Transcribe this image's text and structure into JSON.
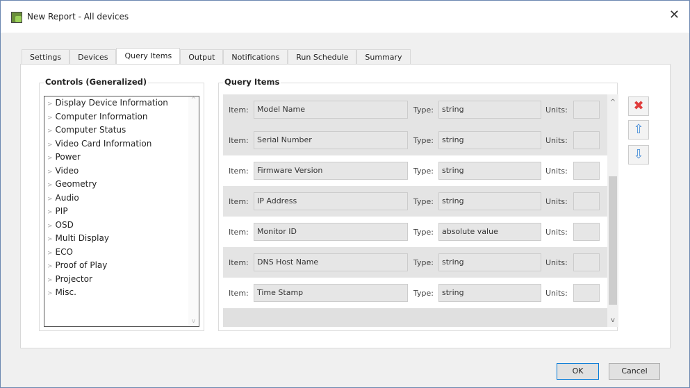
{
  "window": {
    "title": "New Report - All devices"
  },
  "tabs": [
    "Settings",
    "Devices",
    "Query Items",
    "Output",
    "Notifications",
    "Run Schedule",
    "Summary"
  ],
  "active_tab": "Query Items",
  "controls": {
    "label": "Controls (Generalized)",
    "items": [
      "Display Device Information",
      "Computer Information",
      "Computer Status",
      "Video Card Information",
      "Power",
      "Video",
      "Geometry",
      "Audio",
      "PIP",
      "OSD",
      "Multi Display",
      "ECO",
      "Proof of Play",
      "Projector",
      "Misc."
    ]
  },
  "query": {
    "label": "Query Items",
    "item_label": "Item:",
    "type_label": "Type:",
    "units_label": "Units:",
    "rows": [
      {
        "item": "Model Name",
        "type": "string",
        "units": ""
      },
      {
        "item": "Serial Number",
        "type": "string",
        "units": ""
      },
      {
        "item": "Firmware Version",
        "type": "string",
        "units": ""
      },
      {
        "item": "IP Address",
        "type": "string",
        "units": ""
      },
      {
        "item": "Monitor ID",
        "type": "absolute value",
        "units": ""
      },
      {
        "item": "DNS Host Name",
        "type": "string",
        "units": ""
      },
      {
        "item": "Time Stamp",
        "type": "string",
        "units": ""
      }
    ]
  },
  "buttons": {
    "ok": "OK",
    "cancel": "Cancel"
  },
  "colors": {
    "delete": "#e03c3c",
    "arrow": "#4a8fd8"
  }
}
